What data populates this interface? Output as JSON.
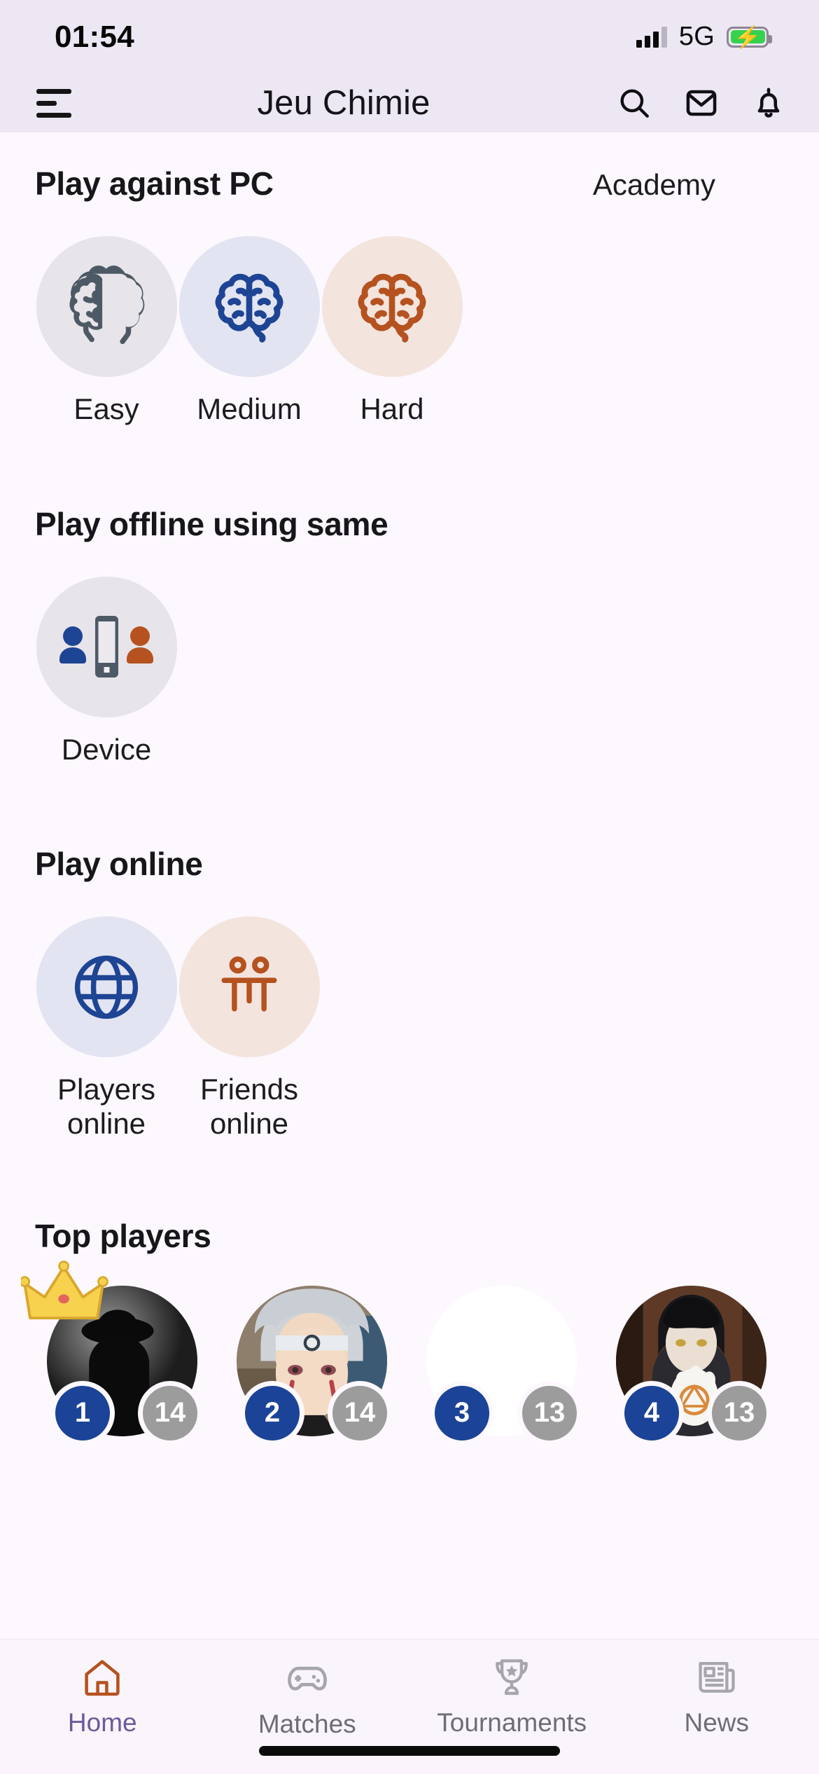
{
  "status_bar": {
    "time": "01:54",
    "network": "5G",
    "signal_icon": "signal-bars-icon",
    "battery_icon": "battery-charging-icon"
  },
  "app_bar": {
    "menu_icon": "hamburger-menu-icon",
    "title": "Jeu Chimie",
    "actions": [
      {
        "name": "search-icon",
        "label": "Search"
      },
      {
        "name": "mail-icon",
        "label": "Messages"
      },
      {
        "name": "bell-icon",
        "label": "Notifications"
      }
    ]
  },
  "sections": {
    "play_against_pc": {
      "title": "Play against PC",
      "link": "Academy",
      "tiles": [
        {
          "label": "Easy",
          "icon": "brain-icon",
          "icon_color": "#4d5a65",
          "bg": "#e7e4ea"
        },
        {
          "label": "Medium",
          "icon": "brain-icon",
          "icon_color": "#1e4494",
          "bg": "#e2e4f1"
        },
        {
          "label": "Hard",
          "icon": "brain-icon",
          "icon_color": "#b5521f",
          "bg": "#f3e4de"
        }
      ]
    },
    "play_offline": {
      "title": "Play offline using same",
      "tiles": [
        {
          "label": "Device",
          "icon": "same-device-icon",
          "bg": "#e7e4ea"
        }
      ]
    },
    "play_online": {
      "title": "Play online",
      "tiles": [
        {
          "label": "Players\nonline",
          "label_line1": "Players",
          "label_line2": "online",
          "icon": "globe-icon",
          "icon_color": "#1e4494",
          "bg": "#e2e4f1"
        },
        {
          "label": "Friends\nonline",
          "label_line1": "Friends",
          "label_line2": "online",
          "icon": "friends-icon",
          "icon_color": "#b5521f",
          "bg": "#f3e4de"
        }
      ]
    },
    "top_players": {
      "title": "Top players",
      "players": [
        {
          "rank": "1",
          "score": "14",
          "crown": true,
          "avatar": "avatar-silhouette-hat"
        },
        {
          "rank": "2",
          "score": "14",
          "crown": false,
          "avatar": "avatar-silver-hair"
        },
        {
          "rank": "3",
          "score": "13",
          "crown": false,
          "avatar": "avatar-blank-white"
        },
        {
          "rank": "4",
          "score": "13",
          "crown": false,
          "avatar": "avatar-dark-hair-hand"
        }
      ]
    }
  },
  "bottom_nav": {
    "items": [
      {
        "label": "Home",
        "icon": "home-icon",
        "active": true
      },
      {
        "label": "Matches",
        "icon": "gamepad-icon",
        "active": false
      },
      {
        "label": "Tournaments",
        "icon": "trophy-icon",
        "active": false
      },
      {
        "label": "News",
        "icon": "newspaper-icon",
        "active": false
      }
    ]
  },
  "colors": {
    "status_bg": "#ece7f3",
    "page_bg": "#fcf8fd",
    "accent_blue": "#1e4494",
    "accent_orange": "#b5521f",
    "nav_active": "#6a5b99",
    "rank_badge": "#1b4397",
    "score_badge": "#9c9c9c"
  }
}
